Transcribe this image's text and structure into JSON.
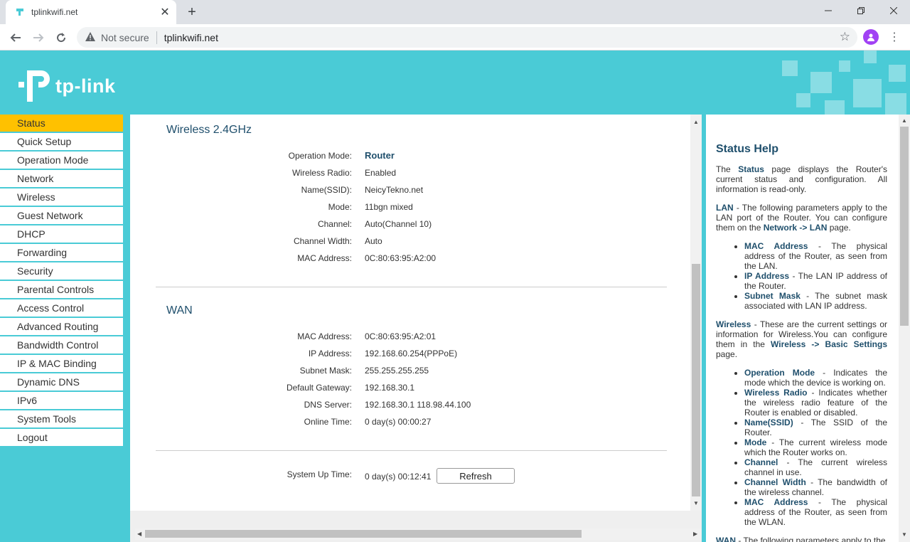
{
  "browser": {
    "tab_title": "tplinkwifi.net",
    "tab_close": "✕",
    "new_tab": "+",
    "security_label": "Not secure",
    "url": "tplinkwifi.net"
  },
  "brand": {
    "logo_text": "tp-link",
    "accent": "#4acbd6",
    "active_menu_color": "#ffc100"
  },
  "sidebar": {
    "items": [
      {
        "label": "Status",
        "active": true
      },
      {
        "label": "Quick Setup"
      },
      {
        "label": "Operation Mode"
      },
      {
        "label": "Network"
      },
      {
        "label": "Wireless"
      },
      {
        "label": "Guest Network"
      },
      {
        "label": "DHCP"
      },
      {
        "label": "Forwarding"
      },
      {
        "label": "Security"
      },
      {
        "label": "Parental Controls"
      },
      {
        "label": "Access Control"
      },
      {
        "label": "Advanced Routing"
      },
      {
        "label": "Bandwidth Control"
      },
      {
        "label": "IP & MAC Binding"
      },
      {
        "label": "Dynamic DNS"
      },
      {
        "label": "IPv6"
      },
      {
        "label": "System Tools"
      },
      {
        "label": "Logout"
      }
    ]
  },
  "wireless": {
    "title": "Wireless 2.4GHz",
    "rows": [
      {
        "label": "Operation Mode:",
        "value": "Router"
      },
      {
        "label": "Wireless Radio:",
        "value": "Enabled"
      },
      {
        "label": "Name(SSID):",
        "value": "NeicyTekno.net"
      },
      {
        "label": "Mode:",
        "value": "11bgn mixed"
      },
      {
        "label": "Channel:",
        "value": "Auto(Channel 10)"
      },
      {
        "label": "Channel Width:",
        "value": "Auto"
      },
      {
        "label": "MAC Address:",
        "value": "0C:80:63:95:A2:00"
      }
    ]
  },
  "wan": {
    "title": "WAN",
    "rows": [
      {
        "label": "MAC Address:",
        "value": "0C:80:63:95:A2:01"
      },
      {
        "label": "IP Address:",
        "value": "192.168.60.254(PPPoE)"
      },
      {
        "label": "Subnet Mask:",
        "value": "255.255.255.255"
      },
      {
        "label": "Default Gateway:",
        "value": "192.168.30.1"
      },
      {
        "label": "DNS Server:",
        "value": "192.168.30.1 118.98.44.100"
      },
      {
        "label": "Online Time:",
        "value": "0 day(s) 00:00:27"
      }
    ]
  },
  "system": {
    "uptime_label": "System Up Time:",
    "uptime_value": "0 day(s) 00:12:41",
    "refresh_label": "Refresh"
  },
  "help": {
    "title": "Status Help",
    "intro_pre": "The ",
    "intro_kw": "Status",
    "intro_post": " page displays the Router's current status and configuration. All information is read-only.",
    "lan_kw": "LAN",
    "lan_text": " - The following parameters apply to the LAN port of the Router. You can configure them on the ",
    "lan_link": "Network -> LAN",
    "lan_tail": " page.",
    "lan_items": [
      {
        "kw": "MAC Address",
        "text": " - The physical address of the Router, as seen from the LAN."
      },
      {
        "kw": "IP Address",
        "text": " - The LAN IP address of the Router."
      },
      {
        "kw": "Subnet Mask",
        "text": " - The subnet mask associated with LAN IP address."
      }
    ],
    "wl_kw": "Wireless",
    "wl_text": " - These are the current settings or information for Wireless.You can configure them in the ",
    "wl_link": "Wireless -> Basic Settings",
    "wl_tail": " page.",
    "wl_items": [
      {
        "kw": "Operation Mode",
        "text": " - Indicates the mode which the device is working on."
      },
      {
        "kw": "Wireless Radio",
        "text": " - Indicates whether the wireless radio feature of the Router is enabled or disabled."
      },
      {
        "kw": "Name(SSID)",
        "text": " - The SSID of the Router."
      },
      {
        "kw": "Mode",
        "text": " - The current wireless mode which the Router works on."
      },
      {
        "kw": "Channel",
        "text": " - The current wireless channel in use."
      },
      {
        "kw": "Channel Width",
        "text": " - The bandwidth of the wireless channel."
      },
      {
        "kw": "MAC Address",
        "text": " - The physical address of the Router, as seen from the WLAN."
      }
    ],
    "wan_kw": "WAN",
    "wan_text": " - The following parameters apply to the"
  }
}
